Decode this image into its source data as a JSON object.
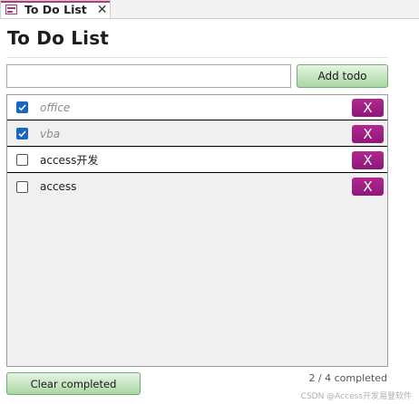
{
  "tab": {
    "title": "To Do List",
    "close": "✕",
    "icon": "form-icon"
  },
  "heading": "To Do List",
  "new_todo": {
    "value": "",
    "placeholder": "",
    "add_label": "Add todo"
  },
  "todos": [
    {
      "text": "office",
      "completed": true,
      "delete_label": "X"
    },
    {
      "text": "vba",
      "completed": true,
      "delete_label": "X"
    },
    {
      "text": "access开发",
      "completed": false,
      "delete_label": "X"
    },
    {
      "text": "access",
      "completed": false,
      "delete_label": "X"
    }
  ],
  "footer": {
    "clear_label": "Clear completed",
    "status": "2 / 4 completed"
  },
  "watermark": "CSDN @Access开发易登软件",
  "colors": {
    "tab_accent": "#b23a7a",
    "add_button": "#a9d7a2",
    "delete_button": "#9b1f85",
    "checkbox_checked": "#1667c3"
  }
}
